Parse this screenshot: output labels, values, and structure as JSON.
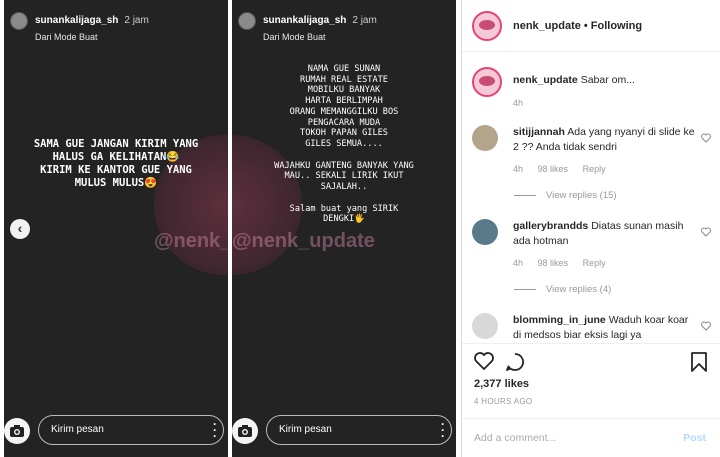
{
  "stories": [
    {
      "username": "sunankalijaga_sh",
      "time": "2 jam",
      "subtitle": "Dari Mode Buat",
      "watermark": "@nenk_update",
      "text": "SAMA GUE JANGAN KIRIM YANG\nHALUS GA KELIHATAN😂\nKIRIM KE KANTOR GUE YANG\nMULUS MULUS😍",
      "message_placeholder": "Kirim pesan"
    },
    {
      "username": "sunankalijaga_sh",
      "time": "2 jam",
      "subtitle": "Dari Mode Buat",
      "watermark": "@nenk_update",
      "text": "NAMA GUE SUNAN\nRUMAH REAL ESTATE\nMOBILKU BANYAK\nHARTA BERLIMPAH\nORANG MEMANGGILKU BOS\nPENGACARA MUDA\nTOKOH PAPAN GILES\nGILES SEMUA....\n\nWAJAHKU GANTENG BANYAK YANG\nMAU.. SEKALI LIRIK IKUT\nSAJALAH..\n\nSalam buat yang SIRIK\nDENGKI🖐",
      "message_placeholder": "Kirim pesan"
    }
  ],
  "post": {
    "username": "nenk_update",
    "follow_status": "• Following",
    "caption": "Sabar om...",
    "caption_time": "4h",
    "comments": [
      {
        "user": "sitijjannah",
        "text": "Ada yang nyanyi di slide ke 2 ?? Anda tidak sendri",
        "time": "4h",
        "likes": "98 likes",
        "reply": "Reply",
        "view_replies": "View replies (15)"
      },
      {
        "user": "gallerybrandds",
        "text": "Diatas sunan masih ada hotman",
        "time": "4h",
        "likes": "98 likes",
        "reply": "Reply",
        "view_replies": "View replies (4)"
      },
      {
        "user": "blomming_in_june",
        "text": "Waduh koar koar di medsos biar eksis lagi ya"
      }
    ],
    "likes": "2,377 likes",
    "posted": "4 HOURS AGO",
    "add_comment_placeholder": "Add a comment...",
    "post_label": "Post"
  }
}
